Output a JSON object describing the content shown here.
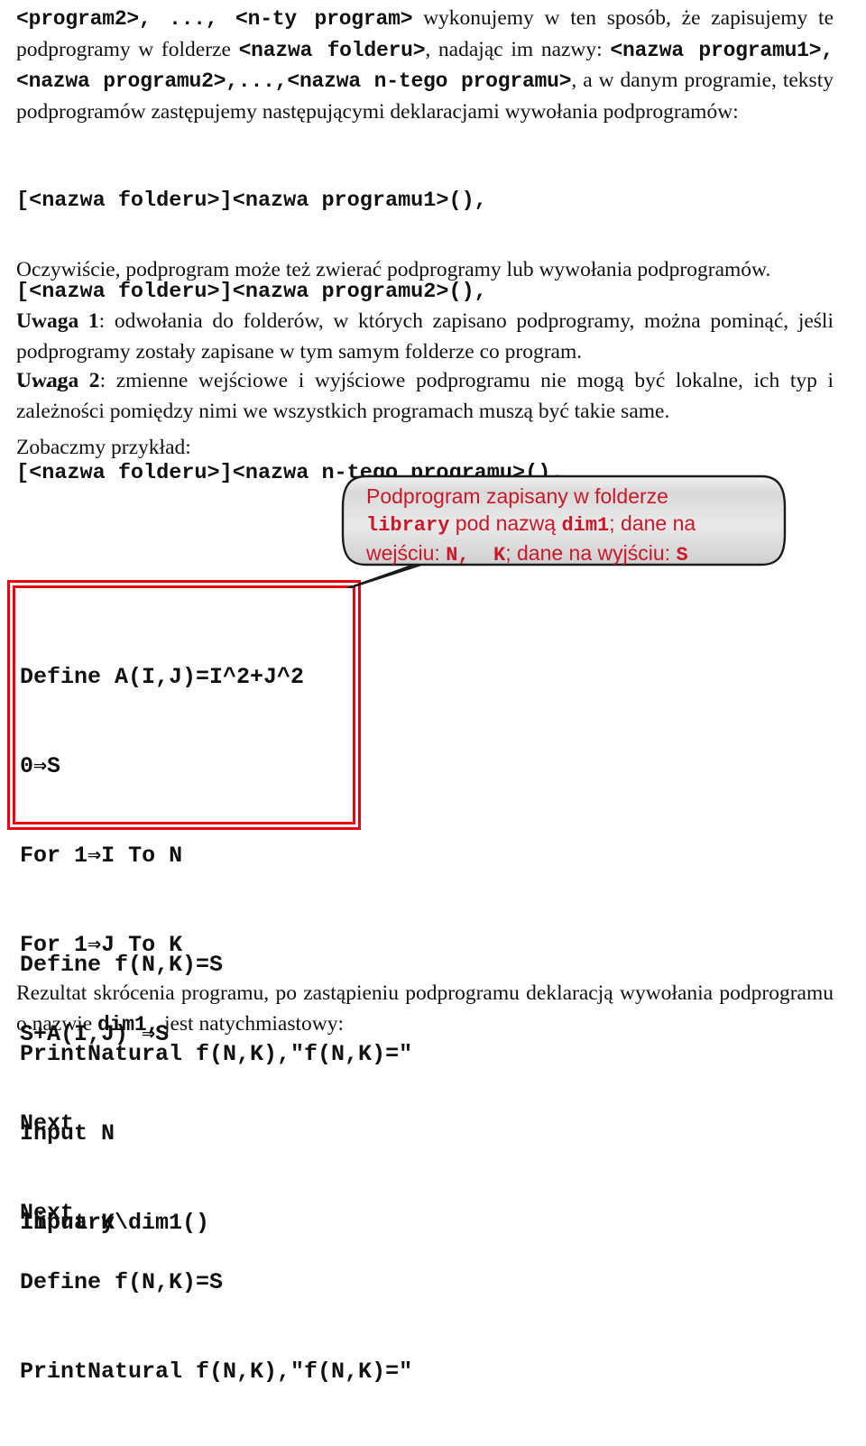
{
  "document": {
    "language": "pl",
    "colors": {
      "red_border": "#E8030F",
      "callout_text": "#C8192A",
      "body_text": "#111111"
    }
  },
  "intro_paragraph": {
    "segments": [
      {
        "text": "<program2>, ..., <n-ty program>",
        "style": "mono"
      },
      {
        "text": " wykonujemy w ten sposób, że zapisujemy te podprogramy w folderze ",
        "style": "serif"
      },
      {
        "text": "<nazwa folderu>",
        "style": "mono"
      },
      {
        "text": ", nadając im nazwy: ",
        "style": "serif"
      },
      {
        "text": "<nazwa programu1>, <nazwa programu2>,...,<nazwa n-tego programu>",
        "style": "mono"
      },
      {
        "text": ", a w danym programie, teksty podprogramów zastępujemy następującymi deklaracjami wywołania podprogramów:",
        "style": "serif"
      }
    ]
  },
  "declaration_list": {
    "lines": [
      "[<nazwa folderu>]<nazwa programu1>(),",
      "[<nazwa folderu>]<nazwa programu2>(),",
      "...,",
      "[<nazwa folderu>]<nazwa n-tego programu>()."
    ]
  },
  "note_obvious": {
    "text": "Oczywiście, podprogram może też zwierać podprogramy lub wywołania podprogramów."
  },
  "note_1": {
    "label": "Uwaga 1",
    "text": ": odwołania do folderów, w których zapisano podprogramy, można pominąć,  jeśli podprogramy zostały zapisane w tym samym folderze co program."
  },
  "note_2": {
    "label": "Uwaga 2",
    "text": ": zmienne wejściowe i wyjściowe podprogramu nie mogą być lokalne, ich typ i zależności pomiędzy nimi we wszystkich programach muszą być takie same."
  },
  "example_lead": {
    "text": "Zobaczmy przykład:"
  },
  "program_head": {
    "lines": [
      "Input N",
      "Input K"
    ]
  },
  "callout": {
    "line1_a": "Podprogram zapisany w folderze",
    "line2_mono1": "library",
    "line2_a": " pod nazwą ",
    "line2_mono2": "dim1",
    "line2_b": "; dane na",
    "line3_a": "wejściu: ",
    "line3_mono1": "N,  K",
    "line3_b": "; dane na wyjściu: ",
    "line3_mono2": "S"
  },
  "subprogram_box": {
    "lines": [
      "Define A(I,J)=I^2+J^2",
      "0⇒S",
      "For 1⇒I To N",
      "For 1⇒J To K",
      "S+A(I,J) ⇒S",
      "Next",
      "Next"
    ]
  },
  "program_tail": {
    "lines": [
      "Define f(N,K)=S",
      "PrintNatural f(N,K),\"f(N,K)=\""
    ]
  },
  "result_paragraph": {
    "part1": "Rezultat skrócenia programu, po zastąpieniu podprogramu deklaracją wywołania podprogramu o nazwie ",
    "mono": "dim1,",
    "part2": "  jest natychmiastowy:"
  },
  "shortened_program": {
    "lines_top": [
      "Input N",
      "Input K"
    ],
    "call_line": "library\\dim1()",
    "lines_bottom": [
      "Define f(N,K)=S",
      "PrintNatural f(N,K),\"f(N,K)=\""
    ]
  }
}
